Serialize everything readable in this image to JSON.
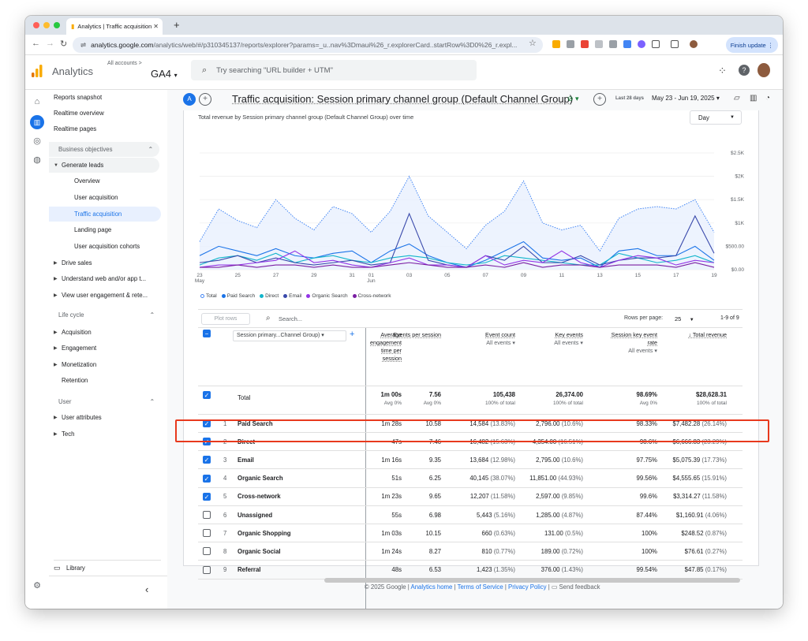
{
  "browser": {
    "tab_title": "Analytics | Traffic acquisition",
    "url_host": "analytics.google.com",
    "url_path": "/analytics/web/#/p310345137/reports/explorer?params=_u..nav%3Dmaui%26_r.explorerCard..startRow%3D0%26_r.expl...",
    "finish_update": "Finish update"
  },
  "app": {
    "name": "Analytics",
    "all_accounts": "All accounts >",
    "property": "GA4",
    "search_placeholder": "Try searching \"URL builder + UTM\""
  },
  "sidebar": {
    "top": [
      "Reports snapshot",
      "Realtime overview",
      "Realtime pages"
    ],
    "business_objectives": "Business objectives",
    "generate_leads": "Generate leads",
    "leads_items": [
      "Overview",
      "User acquisition",
      "Traffic acquisition",
      "Landing page",
      "User acquisition cohorts"
    ],
    "collapsed": [
      "Drive sales",
      "Understand web and/or app t...",
      "View user engagement & rete..."
    ],
    "life_cycle": "Life cycle",
    "life_items": [
      "Acquisition",
      "Engagement",
      "Monetization",
      "Retention"
    ],
    "user": "User",
    "user_items": [
      "User attributes",
      "Tech"
    ],
    "library": "Library"
  },
  "report": {
    "avatar": "A",
    "title": "Traffic acquisition: Session primary channel group (Default Channel Group)",
    "date_label": "Last 28 days",
    "date_range": "May 23 - Jun 19, 2025"
  },
  "chart": {
    "title": "Total revenue by Session primary channel group (Default Channel Group) over time",
    "interval": "Day"
  },
  "chart_data": {
    "type": "line",
    "x": [
      "23 May",
      "24",
      "25",
      "26",
      "27",
      "28",
      "29",
      "30",
      "31",
      "01 Jun",
      "02",
      "03",
      "04",
      "05",
      "06",
      "07",
      "08",
      "09",
      "10",
      "11",
      "12",
      "13",
      "14",
      "15",
      "16",
      "17",
      "18",
      "19"
    ],
    "x_ticks": [
      "23",
      "25",
      "27",
      "29",
      "31",
      "01",
      "03",
      "05",
      "07",
      "09",
      "11",
      "13",
      "15",
      "17",
      "19"
    ],
    "x_tick_sub": {
      "23": "May",
      "01": "Jun"
    },
    "y_ticks": [
      "$0.00",
      "$500.00",
      "$1K",
      "$1.5K",
      "$2K",
      "$2.5K"
    ],
    "ylim": [
      0,
      2500
    ],
    "series": [
      {
        "name": "Total",
        "color": "#4285f4",
        "values": [
          600,
          1300,
          1050,
          900,
          1500,
          1100,
          850,
          1350,
          1200,
          800,
          1250,
          2000,
          1150,
          800,
          450,
          950,
          1250,
          1900,
          1000,
          850,
          950,
          400,
          1100,
          1300,
          1350,
          1300,
          1500,
          800,
          550
        ]
      },
      {
        "name": "Paid Search",
        "color": "#1a73e8",
        "values": [
          300,
          500,
          400,
          300,
          450,
          300,
          250,
          350,
          400,
          150,
          400,
          550,
          300,
          150,
          50,
          200,
          400,
          600,
          250,
          200,
          250,
          50,
          400,
          450,
          300,
          300,
          500,
          200,
          50
        ]
      },
      {
        "name": "Direct",
        "color": "#12b5cb",
        "values": [
          100,
          250,
          300,
          200,
          350,
          150,
          250,
          300,
          200,
          150,
          250,
          300,
          250,
          150,
          100,
          150,
          300,
          250,
          200,
          150,
          100,
          100,
          350,
          250,
          150,
          200,
          300,
          150,
          100
        ]
      },
      {
        "name": "Email",
        "color": "#3949ab",
        "values": [
          150,
          200,
          300,
          150,
          250,
          150,
          100,
          150,
          200,
          100,
          150,
          1200,
          200,
          100,
          50,
          300,
          200,
          500,
          150,
          150,
          300,
          100,
          200,
          250,
          250,
          300,
          1150,
          350,
          50
        ]
      },
      {
        "name": "Organic Search",
        "color": "#9334e6",
        "values": [
          50,
          100,
          100,
          150,
          200,
          400,
          150,
          200,
          100,
          50,
          150,
          250,
          100,
          100,
          50,
          300,
          100,
          200,
          150,
          400,
          150,
          50,
          200,
          300,
          250,
          100,
          200,
          150,
          50
        ]
      },
      {
        "name": "Cross-network",
        "color": "#7b1fa2",
        "values": [
          50,
          50,
          100,
          50,
          100,
          100,
          50,
          100,
          50,
          50,
          100,
          150,
          100,
          50,
          50,
          100,
          50,
          150,
          50,
          100,
          100,
          50,
          100,
          100,
          100,
          50,
          150,
          50,
          50
        ]
      }
    ]
  },
  "table": {
    "plot_rows": "Plot rows",
    "search_placeholder": "Search...",
    "rows_per_page_label": "Rows per page:",
    "rows_per_page": "25",
    "pagination": "1-9 of 9",
    "dimension": "Session primary...Channel Group)",
    "columns": [
      {
        "label": "Average engagement time per session",
        "sub": ""
      },
      {
        "label": "Events per session",
        "sub": ""
      },
      {
        "label": "Event count",
        "sub": "All events"
      },
      {
        "label": "Key events",
        "sub": "All events"
      },
      {
        "label": "Session key event rate",
        "sub": "All events"
      },
      {
        "label": "Total revenue",
        "sub": ""
      }
    ],
    "total": {
      "label": "Total",
      "values": [
        "1m 00s",
        "7.56",
        "105,438",
        "26,374.00",
        "98.69%",
        "$28,628.31"
      ],
      "subs": [
        "Avg 0%",
        "Avg 0%",
        "100% of total",
        "100% of total",
        "Avg 0%",
        "100% of total"
      ]
    },
    "rows": [
      {
        "n": "1",
        "name": "Paid Search",
        "checked": true,
        "values": [
          "1m 28s",
          "10.58",
          "14,584 (13.83%)",
          "2,796.00 (10.6%)",
          "98.33%",
          "$7,482.28 (26.14%)"
        ]
      },
      {
        "n": "2",
        "name": "Direct",
        "checked": true,
        "values": [
          "47s",
          "7.46",
          "16,482 (15.63%)",
          "4,354.00 (16.51%)",
          "98.6%",
          "$6,666.83 (23.29%)"
        ]
      },
      {
        "n": "3",
        "name": "Email",
        "checked": true,
        "values": [
          "1m 16s",
          "9.35",
          "13,684 (12.98%)",
          "2,795.00 (10.6%)",
          "97.75%",
          "$5,075.39 (17.73%)"
        ]
      },
      {
        "n": "4",
        "name": "Organic Search",
        "checked": true,
        "values": [
          "51s",
          "6.25",
          "40,145 (38.07%)",
          "11,851.00 (44.93%)",
          "99.56%",
          "$4,555.65 (15.91%)"
        ]
      },
      {
        "n": "5",
        "name": "Cross-network",
        "checked": true,
        "values": [
          "1m 23s",
          "9.65",
          "12,207 (11.58%)",
          "2,597.00 (9.85%)",
          "99.6%",
          "$3,314.27 (11.58%)"
        ]
      },
      {
        "n": "6",
        "name": "Unassigned",
        "checked": false,
        "values": [
          "55s",
          "6.98",
          "5,443 (5.16%)",
          "1,285.00 (4.87%)",
          "87.44%",
          "$1,160.91 (4.06%)"
        ]
      },
      {
        "n": "7",
        "name": "Organic Shopping",
        "checked": false,
        "values": [
          "1m 03s",
          "10.15",
          "660 (0.63%)",
          "131.00 (0.5%)",
          "100%",
          "$248.52 (0.87%)"
        ]
      },
      {
        "n": "8",
        "name": "Organic Social",
        "checked": false,
        "values": [
          "1m 24s",
          "8.27",
          "810 (0.77%)",
          "189.00 (0.72%)",
          "100%",
          "$76.61 (0.27%)"
        ]
      },
      {
        "n": "9",
        "name": "Referral",
        "checked": false,
        "values": [
          "48s",
          "6.53",
          "1,423 (1.35%)",
          "376.00 (1.43%)",
          "99.54%",
          "$47.85 (0.17%)"
        ]
      }
    ]
  },
  "footer": {
    "copyright": "© 2025 Google |",
    "home": "Analytics home",
    "terms": "Terms of Service",
    "privacy": "Privacy Policy",
    "feedback": "Send feedback"
  }
}
